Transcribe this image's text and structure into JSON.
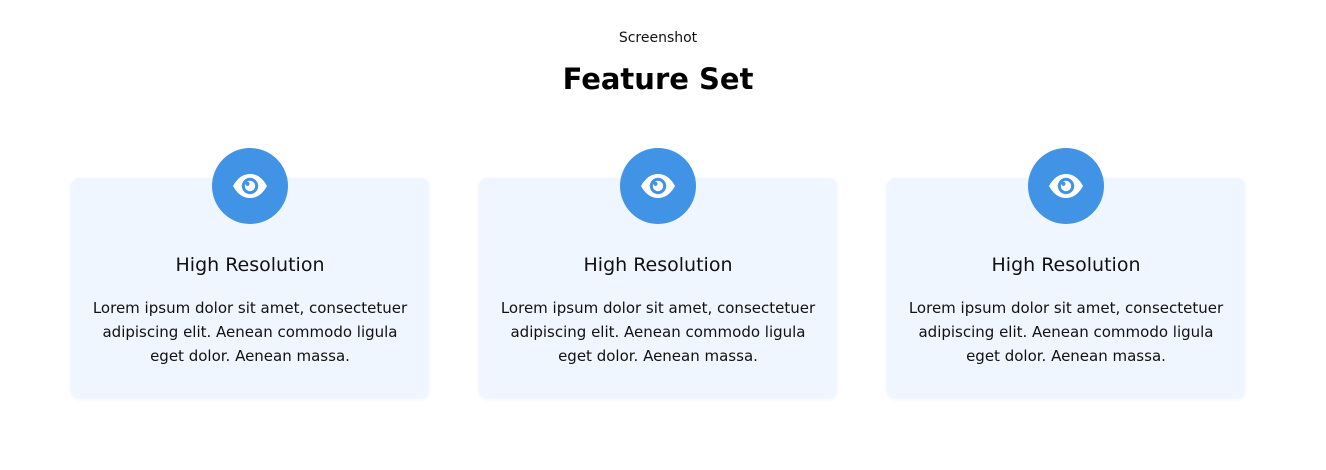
{
  "header": {
    "eyebrow": "Screenshot",
    "title": "Feature Set"
  },
  "features": [
    {
      "icon": "eye-icon",
      "title": "High Resolution",
      "text": "Lorem ipsum dolor sit amet, consectetuer adipiscing elit. Aenean commodo ligula eget dolor. Aenean massa."
    },
    {
      "icon": "eye-icon",
      "title": "High Resolution",
      "text": "Lorem ipsum dolor sit amet, consectetuer adipiscing elit. Aenean commodo ligula eget dolor. Aenean massa."
    },
    {
      "icon": "eye-icon",
      "title": "High Resolution",
      "text": "Lorem ipsum dolor sit amet, consectetuer adipiscing elit. Aenean commodo ligula eget dolor. Aenean massa."
    }
  ],
  "colors": {
    "accent": "#4193e5",
    "card_background": "#f0f6ff",
    "text": "#111111"
  }
}
